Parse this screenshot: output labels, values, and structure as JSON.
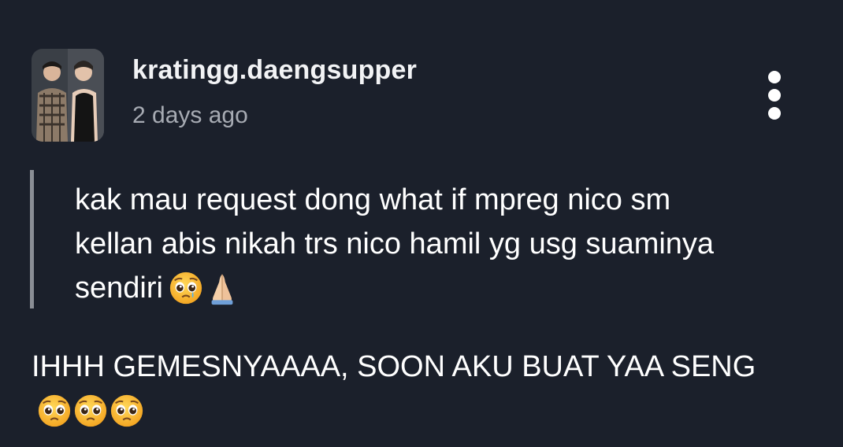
{
  "post": {
    "username": "kratingg.daengsupper",
    "timestamp": "2 days ago",
    "avatar_icon": "profile-photo-two-people",
    "more_icon": "more-vertical-icon"
  },
  "quote": {
    "text": "kak mau request dong what if mpreg nico sm kellan abis nikah trs nico hamil yg usg suaminya sendiri",
    "emojis": [
      "pleading-face-with-tear",
      "folded-hands"
    ]
  },
  "reply": {
    "text": "IHHH GEMESNYAAAA, SOON AKU BUAT YAA SENG",
    "emojis": [
      "pleading-face",
      "pleading-face",
      "pleading-face"
    ]
  },
  "colors": {
    "background": "#1b202b",
    "text": "#ffffff",
    "muted": "#a7abb3",
    "quote_bar": "#8a8e95"
  }
}
